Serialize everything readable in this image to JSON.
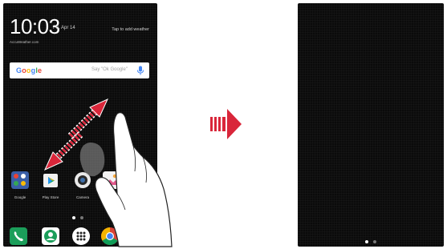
{
  "left_screen": {
    "clock": "10:03",
    "date": "Fri, Apr 14",
    "weather_prompt": "Tap to add weather",
    "weather_source": "AccuWeather.com",
    "search": {
      "logo": "Google",
      "placeholder": "Say \"Ok Google\"",
      "mic_icon": "mic-icon"
    },
    "apps": [
      {
        "label": "Google",
        "icon": "google-folder-icon"
      },
      {
        "label": "Play Store",
        "icon": "play-store-icon"
      },
      {
        "label": "Camera",
        "icon": "camera-icon"
      },
      {
        "label": "Gallery",
        "icon": "gallery-icon"
      }
    ],
    "page_indicator": {
      "count": 2,
      "active": 0
    },
    "dock": [
      {
        "icon": "phone-icon"
      },
      {
        "icon": "contacts-icon"
      },
      {
        "icon": "apps-drawer-icon"
      },
      {
        "icon": "chrome-icon"
      }
    ],
    "gesture": "pinch-zoom-in-gesture"
  },
  "transition_arrow": "arrow-right-icon",
  "right_screen": {
    "page_indicator": {
      "count": 2,
      "active": 0
    }
  },
  "colors": {
    "screen_bg": "#0b0b0b",
    "gesture_arrow": "#d9263a",
    "transition_arrow": "#d9263a",
    "dock_green": "#1b9e5a",
    "dot_active": "#ffffff",
    "dot_inactive": "#777777"
  }
}
